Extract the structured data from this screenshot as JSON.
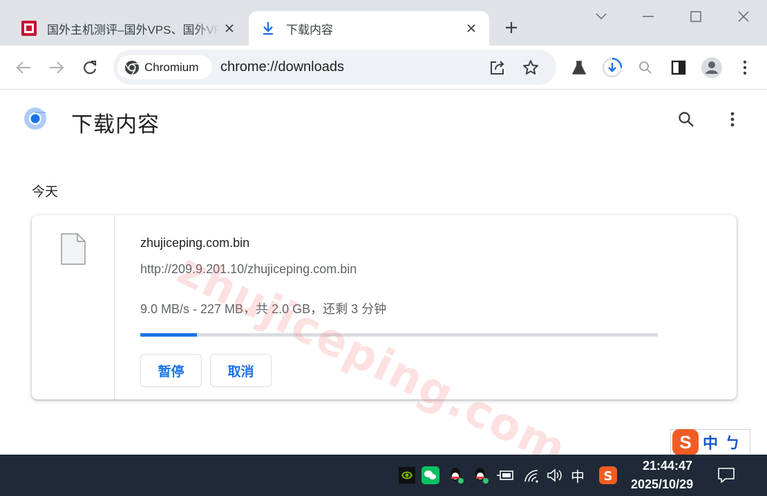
{
  "tabs": [
    {
      "title": "国外主机测评–国外VPS、国外VPS推荐",
      "favicon": "zhujiceping-favicon",
      "active": false
    },
    {
      "title": "下载内容",
      "favicon": "download-icon",
      "active": true
    }
  ],
  "toolbar": {
    "chip_label": "Chromium",
    "url": "chrome://downloads"
  },
  "page": {
    "title": "下载内容",
    "section_date": "今天"
  },
  "download": {
    "filename": "zhujiceping.com.bin",
    "url": "http://209.9.201.10/zhujiceping.com.bin",
    "status": "9.0 MB/s - 227 MB，共 2.0 GB，还剩 3 分钟",
    "progress_fraction": 0.11,
    "pause_label": "暂停",
    "cancel_label": "取消"
  },
  "watermark": "zhujiceping.com",
  "ime": {
    "logo": "S",
    "lang": "中",
    "mode": "ㄅ"
  },
  "taskbar": {
    "ime_indicator": "中",
    "time": "21:44:47",
    "date": "2025/10/29"
  },
  "colors": {
    "accent": "#1a73e8",
    "tabstrip": "#dfe3e7",
    "omnibox": "#eef1f5",
    "taskbar": "#1f2937"
  }
}
